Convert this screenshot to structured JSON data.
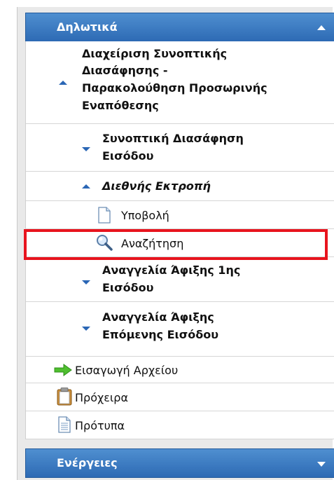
{
  "header": {
    "title": "Δηλωτικά"
  },
  "menu": {
    "items": [
      {
        "label_lines": [
          "Διαχείριση Συνοπτικής",
          "Διασάφησης -",
          "Παρακολούθηση Προσωρινής",
          "Εναπόθεσης"
        ]
      },
      {
        "label_lines": [
          "Συνοπτική Διασάφηση",
          "Εισόδου"
        ]
      },
      {
        "label": "Διεθνής Εκτροπή"
      },
      {
        "label": "Υποβολή",
        "icon": "document-icon"
      },
      {
        "label": "Αναζήτηση",
        "icon": "magnifier-icon"
      },
      {
        "label_lines": [
          "Αναγγελία Άφιξης 1ης",
          "Εισόδου"
        ]
      },
      {
        "label_lines": [
          "Αναγγελία Άφιξης",
          "Επόμενης Εισόδου"
        ]
      },
      {
        "label": "Εισαγωγή Αρχείου",
        "icon": "green-arrow-icon"
      },
      {
        "label": "Πρόχειρα",
        "icon": "clipboard-icon"
      },
      {
        "label": "Πρότυπα",
        "icon": "document-lines-icon"
      }
    ]
  },
  "footer_section": {
    "title": "Ενέργειες"
  },
  "colors": {
    "header_blue": "#2d6ab4",
    "highlight_red": "#e8141e",
    "caret_blue": "#2a66b5"
  }
}
